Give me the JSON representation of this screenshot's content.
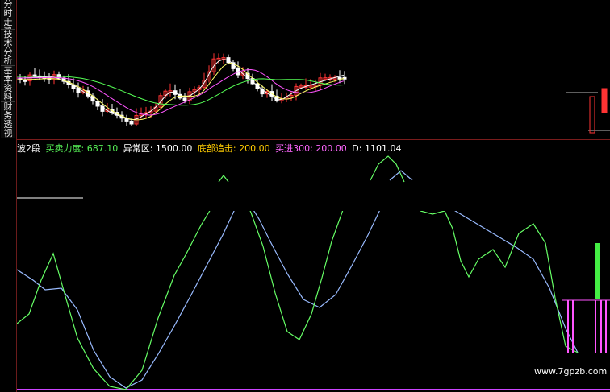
{
  "side_tabs": [
    {
      "label": "分时走势"
    },
    {
      "label": "技术分析"
    },
    {
      "label": "基本资料"
    },
    {
      "label": "财务透视"
    }
  ],
  "indicator": {
    "name": "波2段",
    "items": [
      {
        "label": "买卖力度: 687.10",
        "color": "#55ee55"
      },
      {
        "label": "异常区: 1500.00",
        "color": "#ffffff"
      },
      {
        "label": "底部追击: 200.00",
        "color": "#ffcc00"
      },
      {
        "label": "买进300: 200.00",
        "color": "#ff66ff"
      },
      {
        "label": "D: 1101.04",
        "color": "#ffffff"
      }
    ]
  },
  "watermark": "www.7gpzb.com",
  "colors": {
    "up": "#ff3333",
    "down": "#ffffff",
    "ma_white": "#ffffff",
    "ma_yellow": "#ffff66",
    "ma_magenta": "#ff55ff",
    "ma_green": "#55ff55",
    "fast_line": "#66ff66",
    "slow_line": "#99bbff",
    "baseline": "#cc44ff"
  }
}
